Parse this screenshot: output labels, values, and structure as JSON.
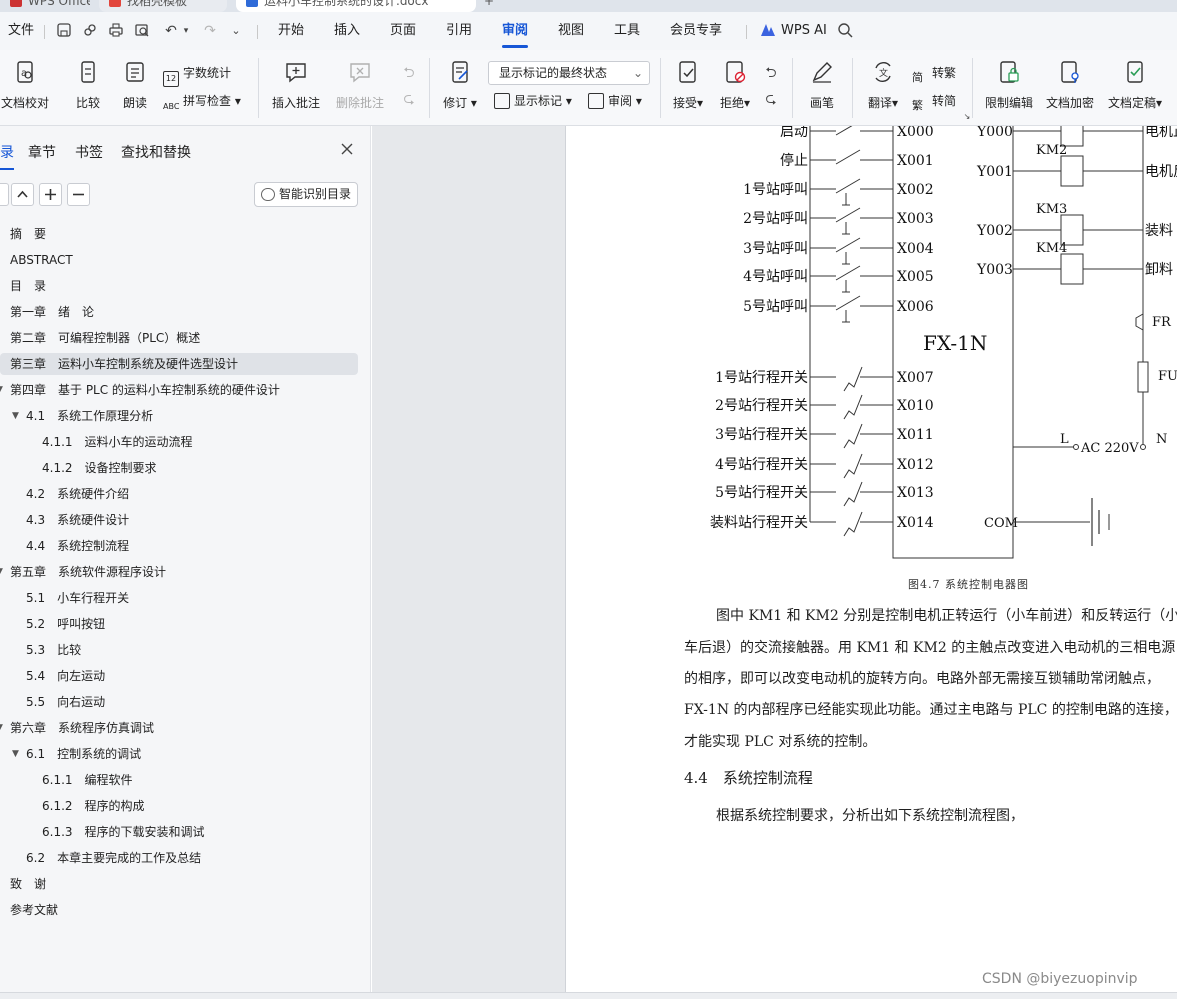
{
  "tabs": [
    {
      "label": "WPS Office",
      "color": "#c33"
    },
    {
      "label": "找稻壳模板",
      "color": "#e2453c"
    },
    {
      "label": "运料小车控制系统的设计.docx",
      "color": "#2f6bd8"
    }
  ],
  "menu": {
    "file": "文件",
    "items": [
      "开始",
      "插入",
      "页面",
      "引用",
      "审阅",
      "视图",
      "工具",
      "会员专享"
    ],
    "active": "审阅",
    "wps_ai": "WPS AI"
  },
  "ribbon": {
    "doc_proof": "文档校对",
    "compare": "比较",
    "read_aloud": "朗读",
    "word_count": "字数统计",
    "spell_check": "拼写检查",
    "insert_comment": "插入批注",
    "delete_comment": "删除批注",
    "track_changes": "修订",
    "markup_dropdown": "显示标记的最终状态",
    "show_markup": "显示标记",
    "review": "审阅",
    "accept": "接受",
    "reject": "拒绝",
    "pen": "画笔",
    "translate": "翻译",
    "to_traditional": "转繁",
    "to_simplified": "转简",
    "restrict_edit": "限制编辑",
    "encrypt": "文档加密",
    "finalize": "文档定稿"
  },
  "nav": {
    "tabs": [
      "目录",
      "章节",
      "书签",
      "查找和替换"
    ],
    "smart_toc": "智能识别目录",
    "toc": [
      {
        "text": "摘　要",
        "level": 0
      },
      {
        "text": "ABSTRACT",
        "level": 0
      },
      {
        "text": "目　录",
        "level": 0
      },
      {
        "text": "第一章　绪　论",
        "level": 0
      },
      {
        "text": "第二章　可编程控制器（PLC）概述",
        "level": 0
      },
      {
        "text": "第三章　运料小车控制系统及硬件选型设计",
        "level": 0
      },
      {
        "text": "第四章　基于 PLC 的运料小车控制系统的硬件设计",
        "level": 0
      },
      {
        "text": "4.1　系统工作原理分析",
        "level": 1
      },
      {
        "text": "4.1.1　运料小车的运动流程",
        "level": 2
      },
      {
        "text": "4.1.2　设备控制要求",
        "level": 2
      },
      {
        "text": "4.2　系统硬件介绍",
        "level": 1
      },
      {
        "text": "4.3　系统硬件设计",
        "level": 1
      },
      {
        "text": "4.4　系统控制流程",
        "level": 1
      },
      {
        "text": "第五章　系统软件源程序设计",
        "level": 0
      },
      {
        "text": "5.1　小车行程开关",
        "level": 1
      },
      {
        "text": "5.2　呼叫按钮",
        "level": 1
      },
      {
        "text": "5.3　比较",
        "level": 1
      },
      {
        "text": "5.4　向左运动",
        "level": 1
      },
      {
        "text": "5.5　向右运动",
        "level": 1
      },
      {
        "text": "第六章　系统程序仿真调试",
        "level": 0
      },
      {
        "text": "6.1　控制系统的调试",
        "level": 1
      },
      {
        "text": "6.1.1　编程软件",
        "level": 2
      },
      {
        "text": "6.1.2　程序的构成",
        "level": 2
      },
      {
        "text": "6.1.3　程序的下载安装和调试",
        "level": 2
      },
      {
        "text": "6.2　本章主要完成的工作及总结",
        "level": 1
      },
      {
        "text": "致　谢",
        "level": 0
      },
      {
        "text": "参考文献",
        "level": 0
      }
    ]
  },
  "diagram": {
    "plc_label": "FX-1N",
    "inputs": [
      {
        "label": "启动",
        "addr": "X000"
      },
      {
        "label": "停止",
        "addr": "X001"
      },
      {
        "label": "1号站呼叫",
        "addr": "X002"
      },
      {
        "label": "2号站呼叫",
        "addr": "X003"
      },
      {
        "label": "3号站呼叫",
        "addr": "X004"
      },
      {
        "label": "4号站呼叫",
        "addr": "X005"
      },
      {
        "label": "5号站呼叫",
        "addr": "X006"
      },
      {
        "label": "1号站行程开关",
        "addr": "X007"
      },
      {
        "label": "2号站行程开关",
        "addr": "X010"
      },
      {
        "label": "3号站行程开关",
        "addr": "X011"
      },
      {
        "label": "4号站行程开关",
        "addr": "X012"
      },
      {
        "label": "5号站行程开关",
        "addr": "X013"
      },
      {
        "label": "装料站行程开关",
        "addr": "X014"
      }
    ],
    "outputs": [
      {
        "addr": "Y000",
        "coil": "",
        "load": "电机正"
      },
      {
        "addr": "Y001",
        "coil": "KM2",
        "load": "电机反"
      },
      {
        "addr": "Y002",
        "coil": "KM3",
        "load": "装料"
      },
      {
        "addr": "Y003",
        "coil": "KM4",
        "load": "卸料"
      }
    ],
    "fr": "FR",
    "fu": "FU",
    "l": "L",
    "ac": "AC 220V",
    "n": "N",
    "com": "COM",
    "caption": "图4.7 系统控制电器图"
  },
  "body": {
    "para1_lines": [
      "图中 KM1 和 KM2 分别是控制电机正转运行（小车前进）和反转运行（小",
      "车后退）的交流接触器。用 KM1 和 KM2 的主触点改变进入电动机的三相电源",
      "的相序，即可以改变电动机的旋转方向。电路外部无需接互锁辅助常闭触点，",
      "FX-1N 的内部程序已经能实现此功能。通过主电路与 PLC 的控制电路的连接，",
      "才能实现 PLC 对系统的控制。"
    ],
    "heading": "4.4　系统控制流程",
    "para2": "根据系统控制要求，分析出如下系统控制流程图，"
  },
  "watermark": "CSDN @biyezuopinvip"
}
